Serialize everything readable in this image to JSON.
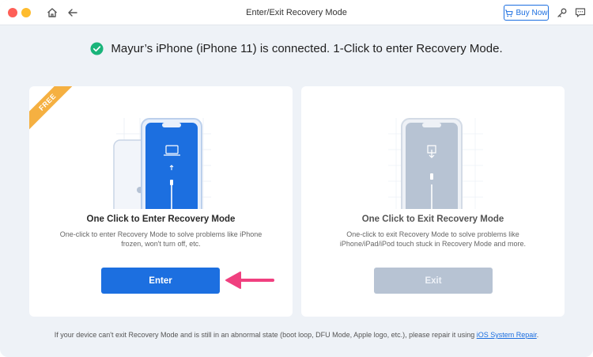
{
  "window": {
    "title": "Enter/Exit Recovery Mode",
    "buy_now_label": "Buy Now"
  },
  "status": {
    "text": "Mayur’s iPhone (iPhone 11) is connected. 1-Click to enter Recovery Mode."
  },
  "cards": {
    "enter": {
      "badge": "FREE",
      "title": "One Click to Enter Recovery Mode",
      "description": "One-click to enter Recovery Mode to solve problems like iPhone frozen, won't turn off, etc.",
      "button_label": "Enter"
    },
    "exit": {
      "title": "One Click to Exit Recovery Mode",
      "description": "One-click to exit Recovery Mode to solve problems like iPhone/iPad/iPod touch stuck in Recovery Mode and more.",
      "button_label": "Exit"
    }
  },
  "footer": {
    "text": "If your device can't exit Recovery Mode and is still in an abnormal state (boot loop, DFU Mode, Apple logo, etc.), please repair it using ",
    "link": "iOS System Repair",
    "suffix": "."
  },
  "colors": {
    "accent": "#1c6fe0",
    "success": "#19b47a",
    "badge": "#f5b041",
    "pointer_arrow": "#f0407f",
    "disabled": "#b7c3d3"
  },
  "icons": {
    "home": "home-icon",
    "back": "back-arrow-icon",
    "cart": "cart-icon",
    "key": "key-icon",
    "feedback": "feedback-icon",
    "status": "check-circle-icon"
  }
}
